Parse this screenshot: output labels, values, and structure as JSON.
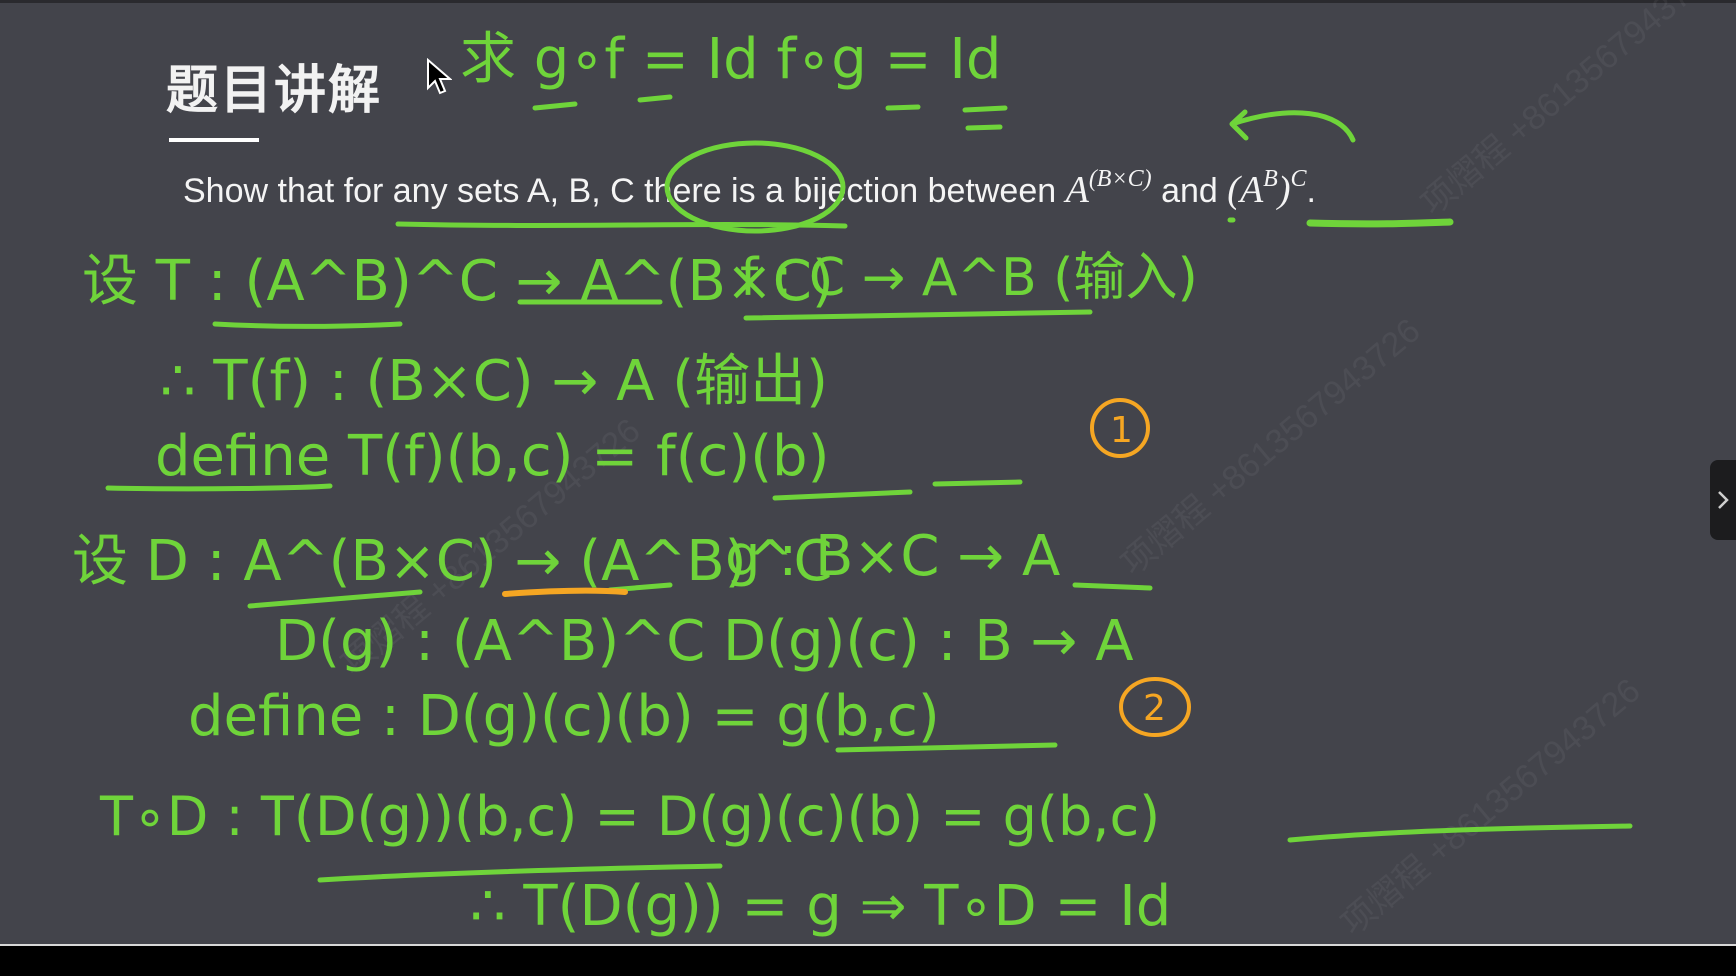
{
  "slide": {
    "title": "题目讲解",
    "question_prefix": "Show that for any sets A, B, C there is a bijection between ",
    "math_1_base": "A",
    "math_1_exp": "(B×C)",
    "question_mid": " and ",
    "math_2_base": "(A",
    "math_2_inner": "B",
    "math_2_close": ")",
    "math_2_exp": "C",
    "question_end": "."
  },
  "annotations": {
    "line_1": "求 g∘f = Id    f∘g = Id",
    "line_2a": "设 T : (A^B)^C → A^(B×C)",
    "line_2b": "f : C → A^B (输入)",
    "line_3": "∴ T(f) : (B×C) → A (输出)",
    "line_4": "define T(f)(b,c) = f(c)(b)",
    "marker_1": "1",
    "line_5a": "设 D : A^(B×C) → (A^B)^C",
    "line_5b": "g : B×C → A",
    "line_6": "D(g) : (A^B)^C   D(g)(c) : B → A",
    "line_7": "define : D(g)(c)(b) = g(b,c)",
    "marker_2": "2",
    "line_8": "T∘D : T(D(g))(b,c) = D(g)(c)(b) = g(b,c)",
    "line_9": "∴ T(D(g)) = g ⇒ T∘D = Id",
    "ink_green": "#6fd43a",
    "ink_orange": "#f5a623"
  },
  "watermark": "项熠程 +8613567943726",
  "controls": {
    "side_tab_icon": "chevron-right-icon",
    "cursor_icon": "mouse-pointer-icon"
  }
}
